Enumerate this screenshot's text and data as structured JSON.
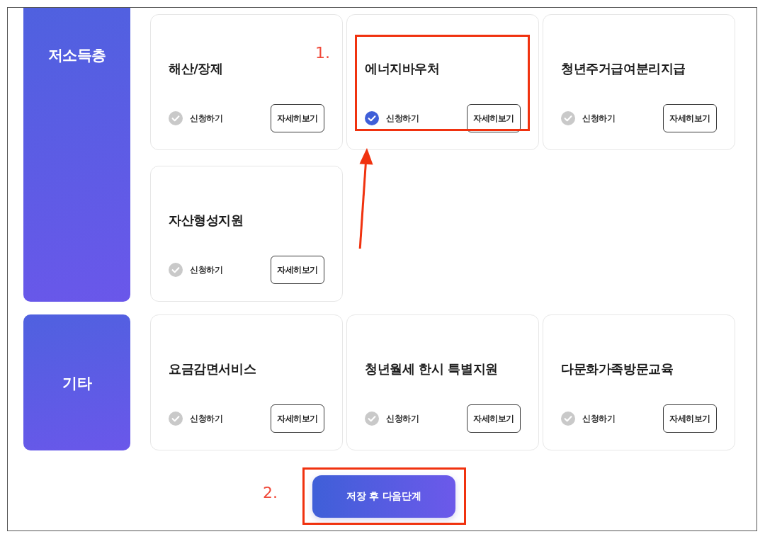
{
  "groups": [
    {
      "category": "저소득층",
      "services": [
        {
          "title": "해산/장제",
          "checked": false,
          "apply_label": "신청하기",
          "detail_button": "자세히보기"
        },
        {
          "title": "에너지바우처",
          "checked": true,
          "apply_label": "신청하기",
          "detail_button": "자세히보기",
          "annotation": "1.",
          "arrow": true
        },
        {
          "title": "청년주거급여분리지급",
          "checked": false,
          "apply_label": "신청하기",
          "detail_button": "자세히보기"
        },
        {
          "title": "자산형성지원",
          "checked": false,
          "apply_label": "신청하기",
          "detail_button": "자세히보기"
        }
      ]
    },
    {
      "category": "기타",
      "services": [
        {
          "title": "요금감면서비스",
          "checked": false,
          "apply_label": "신청하기",
          "detail_button": "자세히보기"
        },
        {
          "title": "청년월세 한시 특별지원",
          "checked": false,
          "apply_label": "신청하기",
          "detail_button": "자세히보기"
        },
        {
          "title": "다문화가족방문교육",
          "checked": false,
          "apply_label": "신청하기",
          "detail_button": "자세히보기"
        }
      ]
    }
  ],
  "submit_button": {
    "label": "저장 후 다음단계",
    "annotation": "2."
  }
}
